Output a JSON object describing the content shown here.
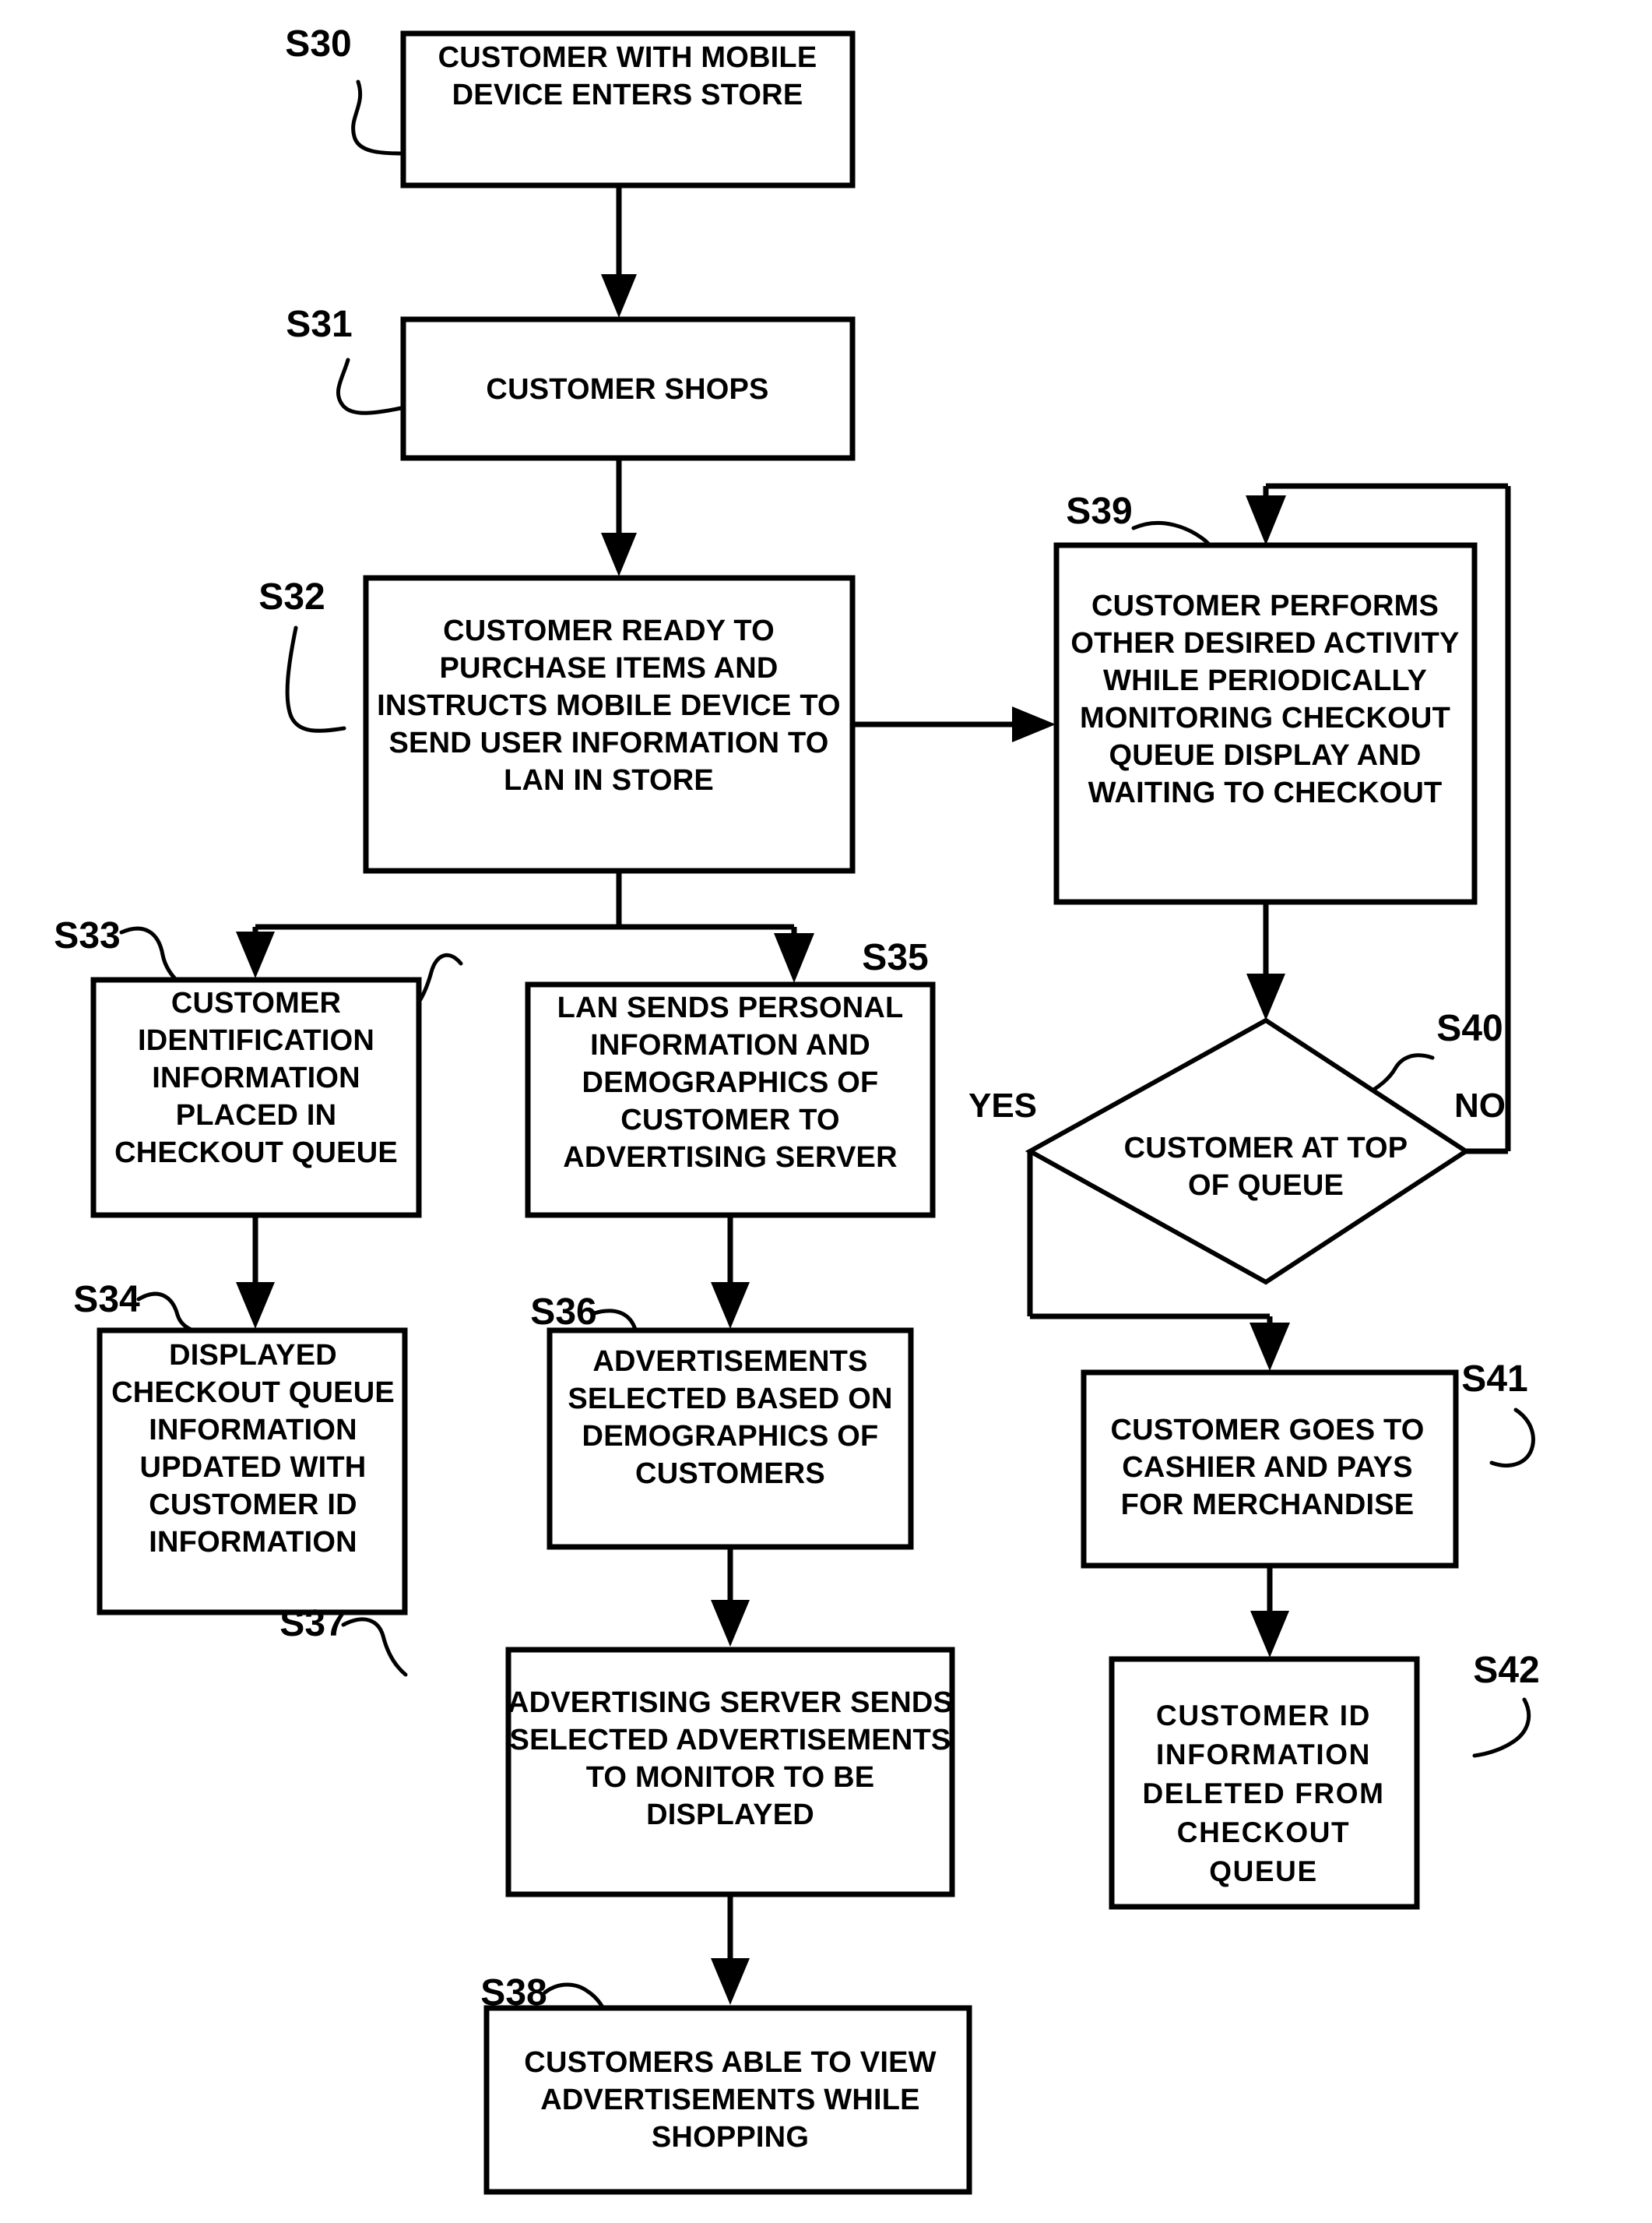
{
  "figure": {
    "type": "patent-flowchart",
    "title": "",
    "background_color": "#ffffff",
    "line_color": "#000000"
  },
  "nodes": {
    "s30": {
      "ref": "S30",
      "shape": "process",
      "lines": [
        "CUSTOMER WITH MOBILE",
        "DEVICE ENTERS STORE"
      ]
    },
    "s31": {
      "ref": "S31",
      "shape": "process",
      "lines": [
        "CUSTOMER SHOPS"
      ]
    },
    "s32": {
      "ref": "S32",
      "shape": "process",
      "lines": [
        "CUSTOMER READY TO",
        "PURCHASE ITEMS AND",
        "INSTRUCTS MOBILE DEVICE TO",
        "SEND USER INFORMATION TO",
        "LAN IN STORE"
      ]
    },
    "s33": {
      "ref": "S33",
      "shape": "process",
      "lines": [
        "CUSTOMER",
        "IDENTIFICATION",
        "INFORMATION",
        "PLACED IN",
        "CHECKOUT QUEUE"
      ]
    },
    "s34": {
      "ref": "S34",
      "shape": "process",
      "lines": [
        "DISPLAYED",
        "CHECKOUT QUEUE",
        "INFORMATION",
        "UPDATED WITH",
        "CUSTOMER ID",
        "INFORMATION"
      ]
    },
    "s35": {
      "ref": "S35",
      "shape": "process",
      "lines": [
        "LAN SENDS PERSONAL",
        "INFORMATION AND",
        "DEMOGRAPHICS OF",
        "CUSTOMER TO",
        "ADVERTISING SERVER"
      ]
    },
    "s36": {
      "ref": "S36",
      "shape": "process",
      "lines": [
        "ADVERTISEMENTS",
        "SELECTED BASED ON",
        "DEMOGRAPHICS OF",
        "CUSTOMERS"
      ]
    },
    "s37": {
      "ref": "S37",
      "shape": "process",
      "lines": [
        "ADVERTISING SERVER SENDS",
        "SELECTED ADVERTISEMENTS",
        "TO MONITOR TO BE",
        "DISPLAYED"
      ]
    },
    "s38": {
      "ref": "S38",
      "shape": "process",
      "lines": [
        "CUSTOMERS ABLE TO VIEW",
        "ADVERTISEMENTS WHILE",
        "SHOPPING"
      ]
    },
    "s39": {
      "ref": "S39",
      "shape": "process",
      "lines": [
        "CUSTOMER PERFORMS",
        "OTHER DESIRED ACTIVITY",
        "WHILE PERIODICALLY",
        "MONITORING CHECKOUT",
        "QUEUE DISPLAY AND",
        "WAITING TO CHECKOUT"
      ]
    },
    "s40": {
      "ref": "S40",
      "shape": "decision",
      "lines": [
        "CUSTOMER AT TOP",
        "OF QUEUE"
      ],
      "yes_label": "YES",
      "no_label": "NO"
    },
    "s41": {
      "ref": "S41",
      "shape": "process",
      "lines": [
        "CUSTOMER GOES TO",
        "CASHIER AND PAYS",
        "FOR MERCHANDISE"
      ]
    },
    "s42": {
      "ref": "S42",
      "shape": "process",
      "lines": [
        "CUSTOMER  ID",
        "INFORMATION",
        "DELETED FROM",
        "CHECKOUT",
        "QUEUE"
      ]
    }
  },
  "edges": [
    {
      "from": "s30",
      "to": "s31",
      "label": ""
    },
    {
      "from": "s31",
      "to": "s32",
      "label": ""
    },
    {
      "from": "s32",
      "to": "s33",
      "label": ""
    },
    {
      "from": "s32",
      "to": "s35",
      "label": ""
    },
    {
      "from": "s32",
      "to": "s39",
      "label": ""
    },
    {
      "from": "s33",
      "to": "s34",
      "label": ""
    },
    {
      "from": "s35",
      "to": "s36",
      "label": ""
    },
    {
      "from": "s36",
      "to": "s37",
      "label": ""
    },
    {
      "from": "s37",
      "to": "s38",
      "label": ""
    },
    {
      "from": "s39",
      "to": "s40",
      "label": ""
    },
    {
      "from": "s40",
      "to": "s41",
      "label": "YES"
    },
    {
      "from": "s40",
      "to": "s39",
      "label": "NO"
    },
    {
      "from": "s41",
      "to": "s42",
      "label": ""
    }
  ]
}
